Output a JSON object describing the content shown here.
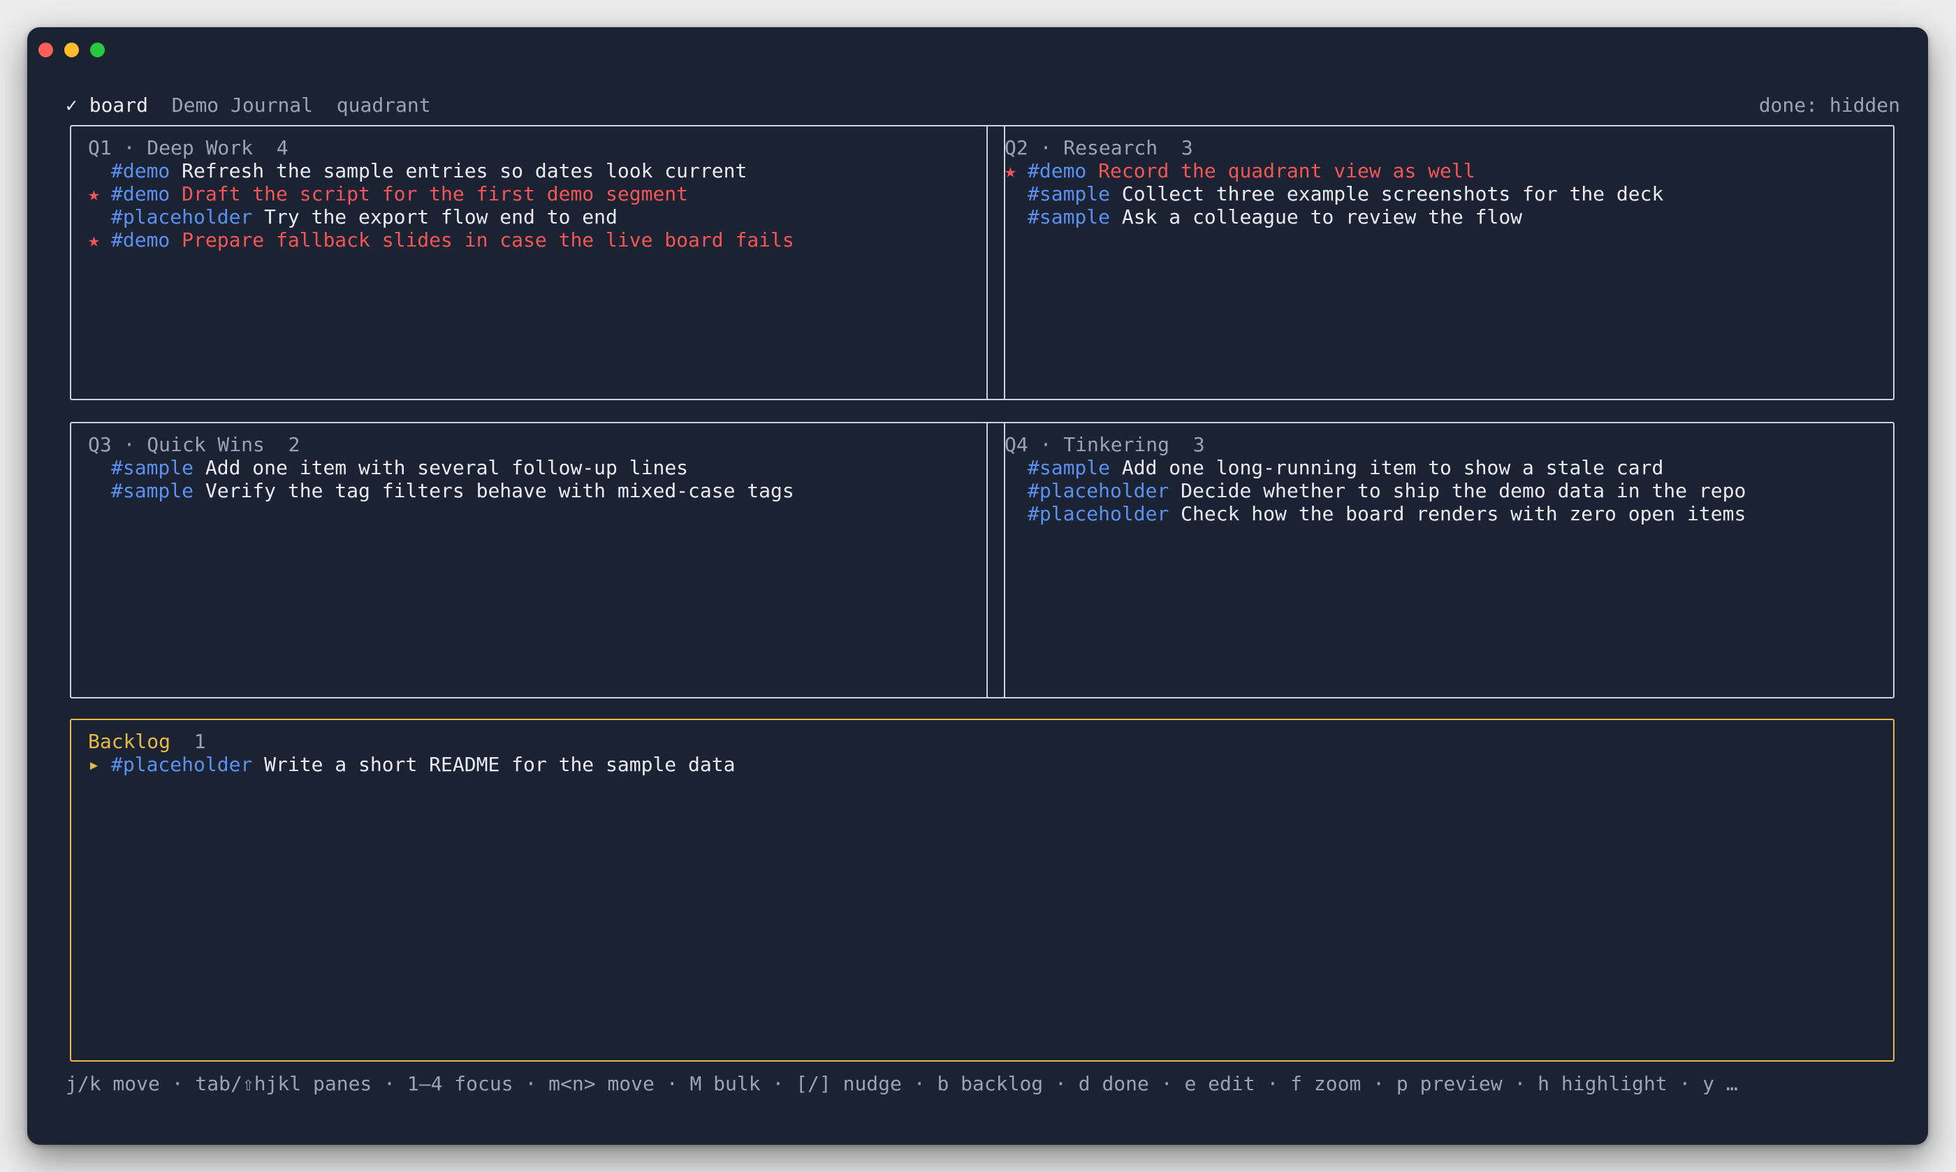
{
  "topbar": {
    "check_mark": "✓",
    "views": [
      {
        "label": "board",
        "active": true
      },
      {
        "label": "Demo Journal",
        "active": false
      },
      {
        "label": "quadrant",
        "active": false
      }
    ],
    "done_status": "done: hidden"
  },
  "panes": {
    "q1": {
      "title": "Q1 · Deep Work",
      "count": "4",
      "items": [
        {
          "mark": "",
          "tag": "#demo",
          "text": "Refresh the sample entries so dates look current",
          "starred": false
        },
        {
          "mark": "★",
          "tag": "#demo",
          "text": "Draft the script for the first demo segment",
          "starred": true
        },
        {
          "mark": "",
          "tag": "#placeholder",
          "text": "Try the export flow end to end",
          "starred": false
        },
        {
          "mark": "★",
          "tag": "#demo",
          "text": "Prepare fallback slides in case the live board fails",
          "starred": true
        }
      ]
    },
    "q2": {
      "title": "Q2 · Research",
      "count": "3",
      "items": [
        {
          "mark": "★",
          "tag": "#demo",
          "text": "Record the quadrant view as well",
          "starred": true
        },
        {
          "mark": "",
          "tag": "#sample",
          "text": "Collect three example screenshots for the deck",
          "starred": false
        },
        {
          "mark": "",
          "tag": "#sample",
          "text": "Ask a colleague to review the flow",
          "starred": false
        }
      ]
    },
    "q3": {
      "title": "Q3 · Quick Wins",
      "count": "2",
      "items": [
        {
          "mark": "",
          "tag": "#sample",
          "text": "Add one item with several follow-up lines",
          "starred": false
        },
        {
          "mark": "",
          "tag": "#sample",
          "text": "Verify the tag filters behave with mixed-case tags",
          "starred": false
        }
      ]
    },
    "q4": {
      "title": "Q4 · Tinkering",
      "count": "3",
      "items": [
        {
          "mark": "",
          "tag": "#sample",
          "text": "Add one long-running item to show a stale card",
          "starred": false
        },
        {
          "mark": "",
          "tag": "#placeholder",
          "text": "Decide whether to ship the demo data in the repo",
          "starred": false
        },
        {
          "mark": "",
          "tag": "#placeholder",
          "text": "Check how the board renders with zero open items",
          "starred": false
        }
      ]
    },
    "backlog": {
      "title": "Backlog",
      "count": "1",
      "items": [
        {
          "mark": "▸",
          "tag": "#placeholder",
          "text": "Write a short README for the sample data",
          "starred": false,
          "cursor": true
        }
      ]
    }
  },
  "footer": {
    "hints": "j/k move · tab/⇧hjkl panes · 1–4 focus · m<n> move · M bulk · [/] nudge · b backlog · d done · e edit · f zoom · p preview · h highlight · y …"
  },
  "colors": {
    "background": "#1b2333",
    "tag": "#5b8ff0",
    "urgent": "#f25555",
    "focus": "#e6b84a",
    "text": "#e8ecf2",
    "muted": "#9aa3b2"
  }
}
